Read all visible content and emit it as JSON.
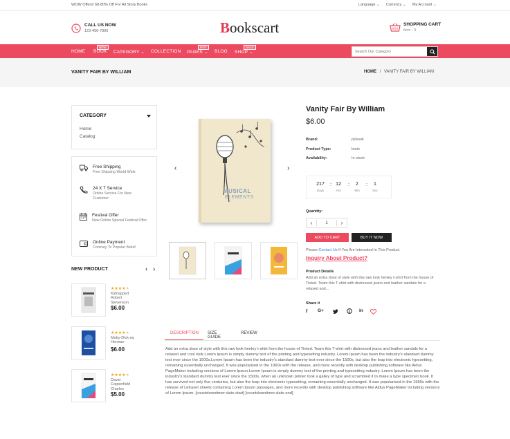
{
  "topbar": {
    "promo": "WOW Offers! 60-80% Off For All Story Books",
    "language": "Language",
    "currency": "Currency",
    "account": "My Account"
  },
  "header": {
    "call_title": "CALL US NOW",
    "call_number": "123-456-7890",
    "logo_first": "B",
    "logo_rest": "ookscart",
    "cart_title": "SHOPPING CART",
    "cart_items": "item - 0"
  },
  "nav": {
    "items": [
      "HOME",
      "BOOK",
      "CATEGORY",
      "COLLECTION",
      "PAGES",
      "BLOG",
      "SHOP"
    ],
    "badges": {
      "book": "NEW",
      "pages": "HOT",
      "shop": "SALE"
    },
    "search_placeholder": "Search Our Category"
  },
  "crumb": {
    "title": "VANITY FAIR BY WILLIAM",
    "home": "HOME",
    "sep": "/",
    "current": "VANITY FAIR BY WILLIAM"
  },
  "sidebar": {
    "category_title": "CATEGORY",
    "categories": [
      "Home",
      "Catalog"
    ],
    "services": [
      {
        "title": "Free Shipping",
        "desc": "Free Shipping World Wide"
      },
      {
        "title": "24 X 7 Service",
        "desc": "Online Service For New Customer"
      },
      {
        "title": "Festival Offer",
        "desc": "New Online Special Festival Offer"
      },
      {
        "title": "Online Payment",
        "desc": "Contrary To Popular Belief."
      }
    ],
    "new_product_title": "NEW PRODUCT",
    "new_products": [
      {
        "name": "Kidnapped Robert Stevenson",
        "price": "$6.00",
        "rating": 4
      },
      {
        "name": "Moby-Dick eq Herman",
        "price": "$6.00",
        "rating": 4
      },
      {
        "name": "David Copperfield Charles",
        "price": "$5.00",
        "rating": 4
      }
    ]
  },
  "product": {
    "title": "Vanity Fair By William",
    "price": "$6.00",
    "brand_label": "Brand:",
    "brand": "psbook",
    "type_label": "Product Type:",
    "type": "book",
    "avail_label": "Availability:",
    "avail": "In stock",
    "cover_line1": "MUSICAL",
    "cover_line2": "ELEMENTS",
    "timer": {
      "days": "217",
      "hrs": "12",
      "min": "2",
      "sec": "1",
      "days_label": "Days",
      "hrs_label": "Hrs",
      "min_label": "Min",
      "sec_label": "Sec"
    },
    "quantity_label": "Quantity:",
    "quantity": "1",
    "add_to_cart": "ADD TO CART",
    "buy_now": "BUY IT NOW",
    "contact_pre": "Please",
    "contact_link": "Contact Us",
    "contact_post": "If You Are Interested In This Product.",
    "inquiry": "Inquiry About Product?",
    "details_title": "Product Details",
    "details_text": "Add an extra dose of style with this raw look henley t-shirt from the house of Tinted. Team this T-shirt with distressed jeans and leather sandals for a relaxed and...",
    "share_title": "Share it"
  },
  "tabs": {
    "items": [
      "DESCRIPTION",
      "SIZE GUIDE",
      "REVIEW"
    ],
    "active": "DESCRIPTION",
    "description": "Add an extra dose of style with this raw look henley t-shirt from the house of Tinted. Team this T-shirt with distressed jeans and leather sandals for a relaxed and cool look.Lorem Ipsum is simply dummy text of the printing and typesetting industry. Lorem Ipsum has been the industry's standard dummy text ever since the 1500s.Lorem Ipsum has been the industry's standard dummy text ever since the 1500s, but also the leap into electronic typesetting, remaining essentially unchanged. It was popularised in the 1960s with the release, and more recently with desktop publishing software like Aldus PageMaker including versions of Lorem Ipsum.Lorem Ipsum is simply dummy text of the printing and typesetting industry. Lorem Ipsum has been the industry's standard dummy text ever since the 1500s, when an unknown printer took a galley of type and scrambled it to make a type specimen book. It has survived not only five centuries, but also the leap into electronic typesetting, remaining essentially unchanged. It was popularised in the 1960s with the release of Letraset sheets containing Lorem Ipsum passages, and more recently with desktop publishing software like Aldus PageMaker including versions of Lorem Ipsum. [countdowntimer-date-start] [countdowntimer-date-end]"
  },
  "colors": {
    "accent": "#ec4a5f",
    "dark": "#222222"
  }
}
